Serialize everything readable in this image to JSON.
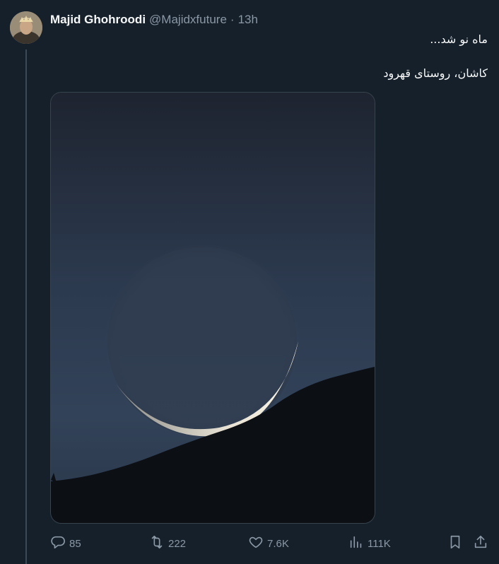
{
  "author": {
    "name": "Majid Ghohroodi",
    "handle": "@Majidxfuture",
    "separator": "·",
    "time": "13h"
  },
  "tweet": {
    "line1": "ماه نو شد...",
    "line2": "کاشان، روستای قهرود"
  },
  "media": {
    "alt": "crescent-moon-photo"
  },
  "actions": {
    "replies": "85",
    "retweets": "222",
    "likes": "7.6K",
    "views": "111K"
  },
  "icons": {
    "reply": "reply-icon",
    "retweet": "retweet-icon",
    "like": "heart-icon",
    "views": "views-icon",
    "bookmark": "bookmark-icon",
    "share": "share-icon"
  },
  "colors": {
    "background": "#15202b",
    "text": "#f7f9f9",
    "muted": "#8b98a5"
  }
}
